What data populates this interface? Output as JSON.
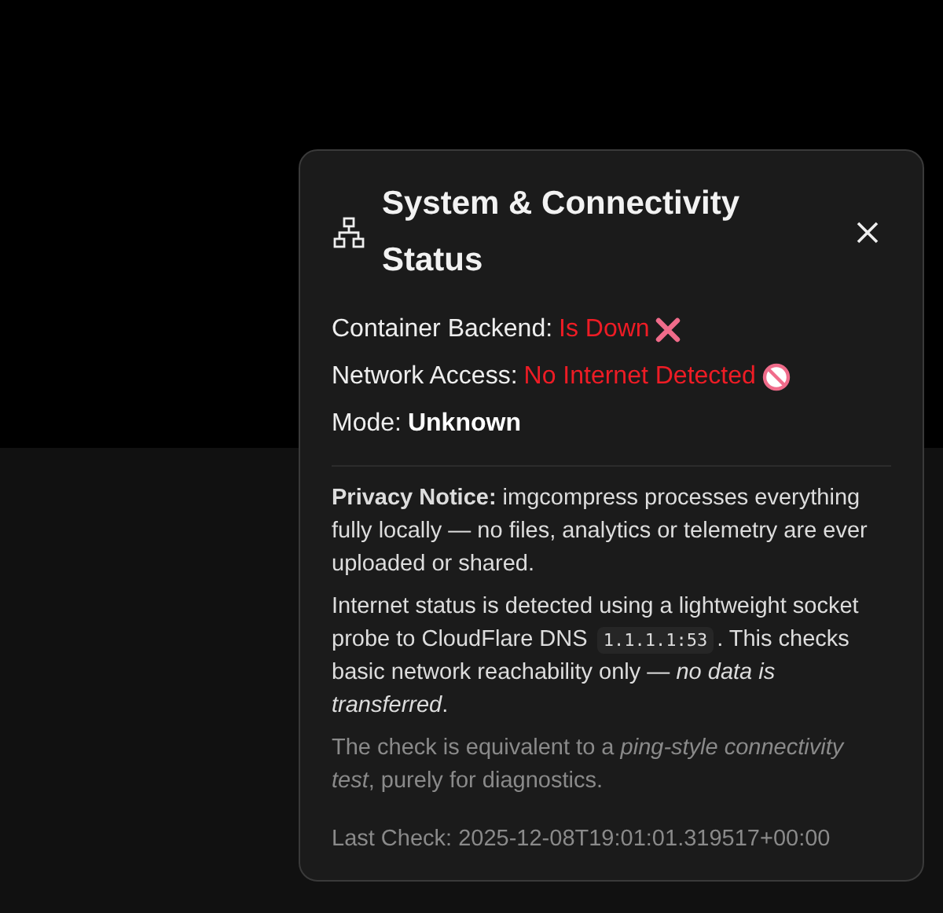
{
  "dialog": {
    "title": "System & Connectivity Status",
    "status_rows": [
      {
        "label": "Container Backend:",
        "value": "Is Down",
        "kind": "down"
      },
      {
        "label": "Network Access:",
        "value": "No Internet Detected",
        "kind": "offline"
      },
      {
        "label": "Mode:",
        "value": "Unknown",
        "kind": "unknown"
      }
    ],
    "privacy_notice": "**Privacy Notice:** imgcompress processes everything fully locally — no files, analytics or telemetry are ever uploaded or shared.",
    "internet_note": {
      "before": "Internet status is detected using a lightweight socket probe to CloudFlare DNS",
      "code": "1.1.1.1:53",
      "after": ". This checks basic network reachability only — *no data is transferred*."
    },
    "check_note": "The check is equivalent to a *ping-style connectivity test*, purely for diagnostics.",
    "last_check": "Last Check: 2025-12-08T19:01:01.319517+00:00"
  }
}
